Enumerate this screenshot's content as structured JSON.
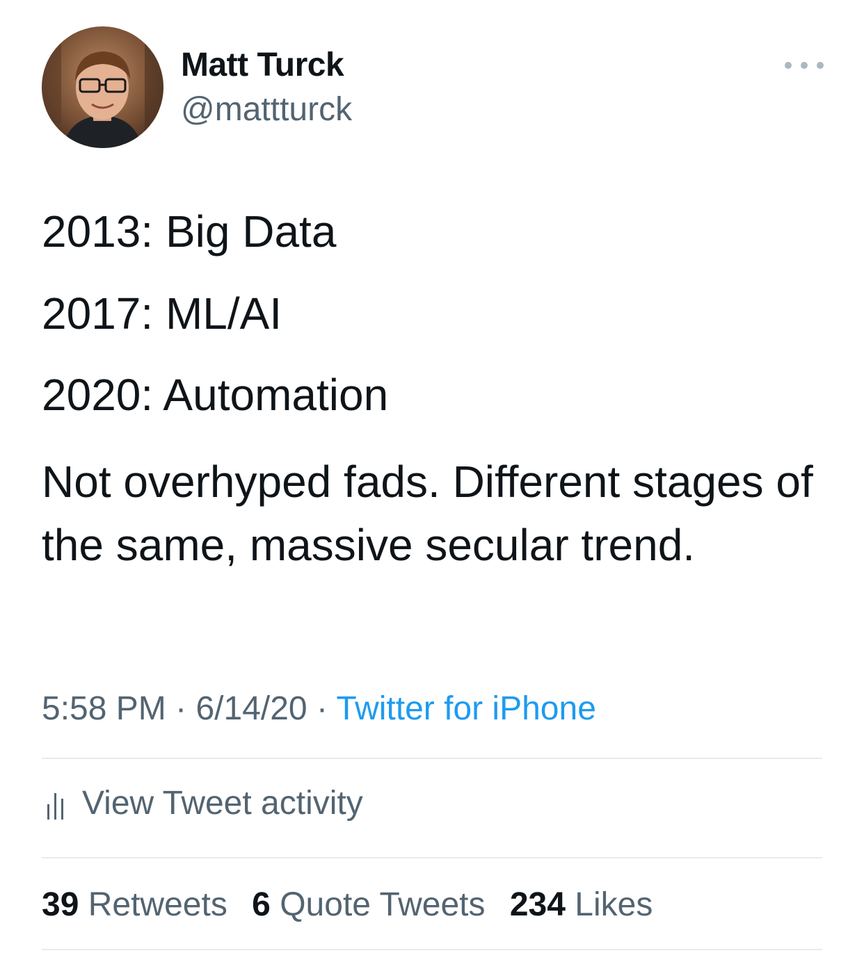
{
  "author": {
    "name": "Matt Turck",
    "handle": "@mattturck",
    "avatar_icon": "profile-photo"
  },
  "more_icon": "more-horizontal-icon",
  "tweet": {
    "lines": [
      "2013: Big Data",
      "2017: ML/AI",
      "2020: Automation"
    ],
    "paragraph": "Not overhyped fads.  Different stages of the same, massive secular trend."
  },
  "meta": {
    "time": "5:58 PM",
    "separator": "·",
    "date": "6/14/20",
    "source": "Twitter for iPhone"
  },
  "activity": {
    "label": "View Tweet activity",
    "icon": "bar-chart-icon"
  },
  "stats": {
    "retweets_count": "39",
    "retweets_label": "Retweets",
    "quotes_count": "6",
    "quotes_label": "Quote Tweets",
    "likes_count": "234",
    "likes_label": "Likes"
  },
  "colors": {
    "text_primary": "#0f1419",
    "text_secondary": "#536471",
    "link": "#1d9bf0",
    "divider": "#e7ebee"
  }
}
